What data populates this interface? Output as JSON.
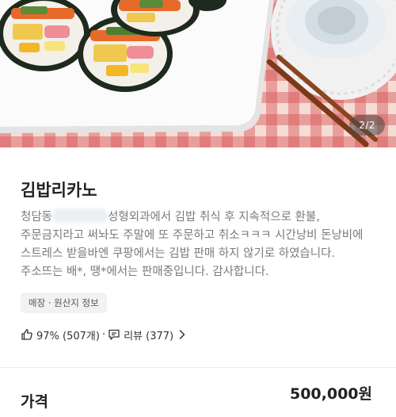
{
  "hero": {
    "image": "gimbap-photo",
    "page_indicator": "2/2"
  },
  "product": {
    "title": "김밥리카노",
    "description_lines": [
      [
        "청담동",
        "성형외과에서 김밥 취식 후 지속적으로 환불,"
      ],
      "주문금지라고 써놔도 주말에 또 주문하고 취소ㅋㅋㅋ 시간낭비 돈낭비에",
      "스트레스 받을바엔 쿠팡에서는 김밥 판매 하지 않기로 하였습니다.",
      "주소뜨는 배*, 땡*에서는 판매중입니다. 감사합니다."
    ],
    "info_chip": "매장 · 원산지 정보",
    "rating": "97% (507개)",
    "separator": "·",
    "reviews": "리뷰 (377)",
    "price_label": "가격",
    "price": "500,000원"
  },
  "icons": {
    "thumbs_up": "thumbs-up-icon",
    "review": "speech-bubble-icon",
    "chevron": "chevron-right-icon"
  },
  "colors": {
    "checkered_cloth": "#d65454",
    "indicator_bg": "#464646",
    "chip_bg": "#f1f2f4",
    "description_text": "#7a7a7a"
  }
}
